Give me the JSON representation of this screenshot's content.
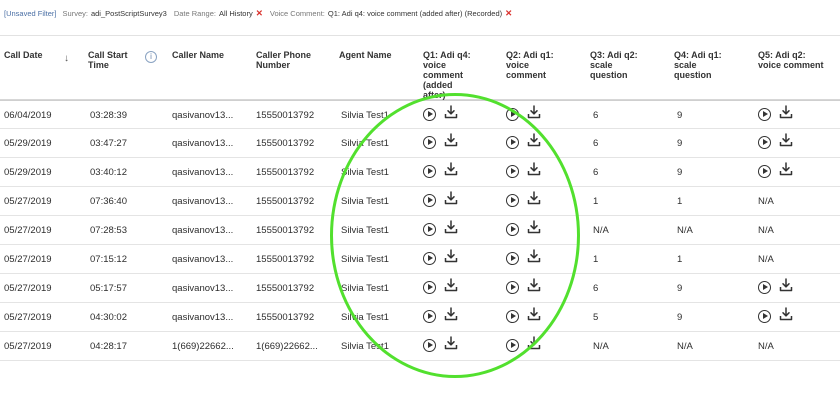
{
  "filters": {
    "unsaved": "[Unsaved Filter]",
    "items": [
      {
        "key": "Survey:",
        "value": "adi_PostScriptSurvey3",
        "removable": false
      },
      {
        "key": "Date Range:",
        "value": "All History",
        "removable": true
      },
      {
        "key": "Voice Comment:",
        "value": "Q1: Adi q4: voice comment (added after) (Recorded)",
        "removable": true
      }
    ],
    "remove_glyph": "✕"
  },
  "table": {
    "headers": {
      "call_date": "Call Date",
      "call_start_time": [
        "Call Start",
        "Time"
      ],
      "caller_name": "Caller Name",
      "caller_phone": [
        "Caller Phone",
        "Number"
      ],
      "agent_name": "Agent Name",
      "q1": [
        "Q1: Adi q4:",
        "voice",
        "comment",
        "(added",
        "after)"
      ],
      "q2": [
        "Q2: Adi q1:",
        "voice",
        "comment"
      ],
      "q3": [
        "Q3: Adi q2:",
        "scale",
        "question"
      ],
      "q4": [
        "Q4: Adi q1:",
        "scale",
        "question"
      ],
      "q5": [
        "Q5: Adi q2:",
        "voice comment"
      ]
    },
    "sort_icon": "↓",
    "info_icon": "i",
    "rows": [
      {
        "date": "06/04/2019",
        "time": "03:28:39",
        "caller": "qasivanov13...",
        "phone": "15550013792",
        "agent": "Silvia Test1",
        "q1": "audio",
        "q2": "audio",
        "q3": "6",
        "q4": "9",
        "q5": "audio"
      },
      {
        "date": "05/29/2019",
        "time": "03:47:27",
        "caller": "qasivanov13...",
        "phone": "15550013792",
        "agent": "Silvia Test1",
        "q1": "audio",
        "q2": "audio",
        "q3": "6",
        "q4": "9",
        "q5": "audio"
      },
      {
        "date": "05/29/2019",
        "time": "03:40:12",
        "caller": "qasivanov13...",
        "phone": "15550013792",
        "agent": "Silvia Test1",
        "q1": "audio",
        "q2": "audio",
        "q3": "6",
        "q4": "9",
        "q5": "audio"
      },
      {
        "date": "05/27/2019",
        "time": "07:36:40",
        "caller": "qasivanov13...",
        "phone": "15550013792",
        "agent": "Silvia Test1",
        "q1": "audio",
        "q2": "audio",
        "q3": "1",
        "q4": "1",
        "q5": "N/A"
      },
      {
        "date": "05/27/2019",
        "time": "07:28:53",
        "caller": "qasivanov13...",
        "phone": "15550013792",
        "agent": "Silvia Test1",
        "q1": "audio",
        "q2": "audio",
        "q3": "N/A",
        "q4": "N/A",
        "q5": "N/A"
      },
      {
        "date": "05/27/2019",
        "time": "07:15:12",
        "caller": "qasivanov13...",
        "phone": "15550013792",
        "agent": "Silvia Test1",
        "q1": "audio",
        "q2": "audio",
        "q3": "1",
        "q4": "1",
        "q5": "N/A"
      },
      {
        "date": "05/27/2019",
        "time": "05:17:57",
        "caller": "qasivanov13...",
        "phone": "15550013792",
        "agent": "Silvia Test1",
        "q1": "audio",
        "q2": "audio",
        "q3": "6",
        "q4": "9",
        "q5": "audio"
      },
      {
        "date": "05/27/2019",
        "time": "04:30:02",
        "caller": "qasivanov13...",
        "phone": "15550013792",
        "agent": "Silvia Test1",
        "q1": "audio",
        "q2": "audio",
        "q3": "5",
        "q4": "9",
        "q5": "audio"
      },
      {
        "date": "05/27/2019",
        "time": "04:28:17",
        "caller": "1(669)22662...",
        "phone": "1(669)22662...",
        "agent": "Silvia Test1",
        "q1": "audio",
        "q2": "audio",
        "q3": "N/A",
        "q4": "N/A",
        "q5": "N/A"
      }
    ]
  },
  "annotation": {
    "color": "#52e02e"
  }
}
